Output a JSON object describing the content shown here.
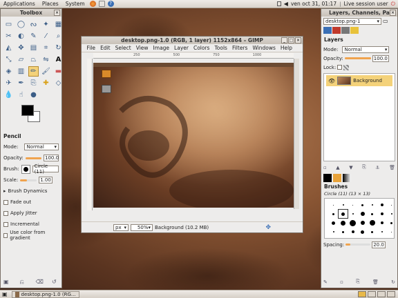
{
  "top_panel": {
    "menus": [
      "Applications",
      "Places",
      "System"
    ],
    "datetime": "ven oct 31, 01:17",
    "session": "Live session user"
  },
  "toolbox": {
    "title": "Toolbox",
    "tool_options": {
      "heading": "Pencil",
      "mode_label": "Mode:",
      "mode_value": "Normal",
      "opacity_label": "Opacity:",
      "opacity_value": "100.0",
      "opacity_fraction": 1.0,
      "brush_label": "Brush:",
      "brush_value": "Circle (11)",
      "scale_label": "Scale:",
      "scale_value": "1.00",
      "brush_dynamics": "Brush Dynamics",
      "fade_out": "Fade out",
      "apply_jitter": "Apply Jitter",
      "incremental": "Incremental",
      "use_color_gradient": "Use color from gradient"
    }
  },
  "image_window": {
    "title": "desktop.png-1.0 (RGB, 1 layer) 1152x864 – GIMP",
    "menus": [
      "File",
      "Edit",
      "Select",
      "View",
      "Image",
      "Layer",
      "Colors",
      "Tools",
      "Filters",
      "Windows",
      "Help"
    ],
    "ruler_marks": [
      "250",
      "500",
      "750",
      "1000"
    ],
    "status": {
      "unit": "px",
      "zoom": "50%",
      "info": "Background (10.2 MB)"
    }
  },
  "layers_dock": {
    "title": "Layers, Channels, Pa",
    "image_select": "desktop.png-1",
    "section_title": "Layers",
    "mode_label": "Mode:",
    "mode_value": "Normal",
    "opacity_label": "Opacity:",
    "opacity_value": "100.0",
    "opacity_fraction": 1.0,
    "lock_label": "Lock:",
    "layer_name": "Background",
    "brushes_title": "Brushes",
    "brush_info": "Circle (11) (13 × 13)",
    "spacing_label": "Spacing:",
    "spacing_value": "20.0",
    "spacing_fraction": 0.2
  },
  "taskbar": {
    "task_label": "desktop.png-1.0 (RG..."
  }
}
